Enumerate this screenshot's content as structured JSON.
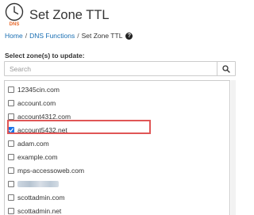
{
  "header": {
    "title": "Set Zone TTL",
    "icon_badge": "DNS",
    "icon": "clock-icon",
    "icon_color": "#e86a2c"
  },
  "breadcrumb": {
    "home": "Home",
    "separator": "/",
    "section": "DNS Functions",
    "current": "Set Zone TTL",
    "help": "?"
  },
  "zones_section": {
    "label": "Select zone(s) to update:",
    "search_placeholder": "Search",
    "search_icon": "magnifier-icon",
    "zones": [
      {
        "name": "12345cin.com",
        "checked": false,
        "redacted": false
      },
      {
        "name": "account.com",
        "checked": false,
        "redacted": false
      },
      {
        "name": "account4312.com",
        "checked": false,
        "redacted": false
      },
      {
        "name": "account5432.net",
        "checked": true,
        "redacted": false
      },
      {
        "name": "adam.com",
        "checked": false,
        "redacted": false
      },
      {
        "name": "example.com",
        "checked": false,
        "redacted": false
      },
      {
        "name": "mps-accessoweb.com",
        "checked": false,
        "redacted": false
      },
      {
        "name": "",
        "checked": false,
        "redacted": true
      },
      {
        "name": "scottadmin.com",
        "checked": false,
        "redacted": false
      },
      {
        "name": "scottadmin.net",
        "checked": false,
        "redacted": false
      }
    ],
    "highlight_color": "#e05656",
    "checkbox_color": "#1a73e8"
  }
}
